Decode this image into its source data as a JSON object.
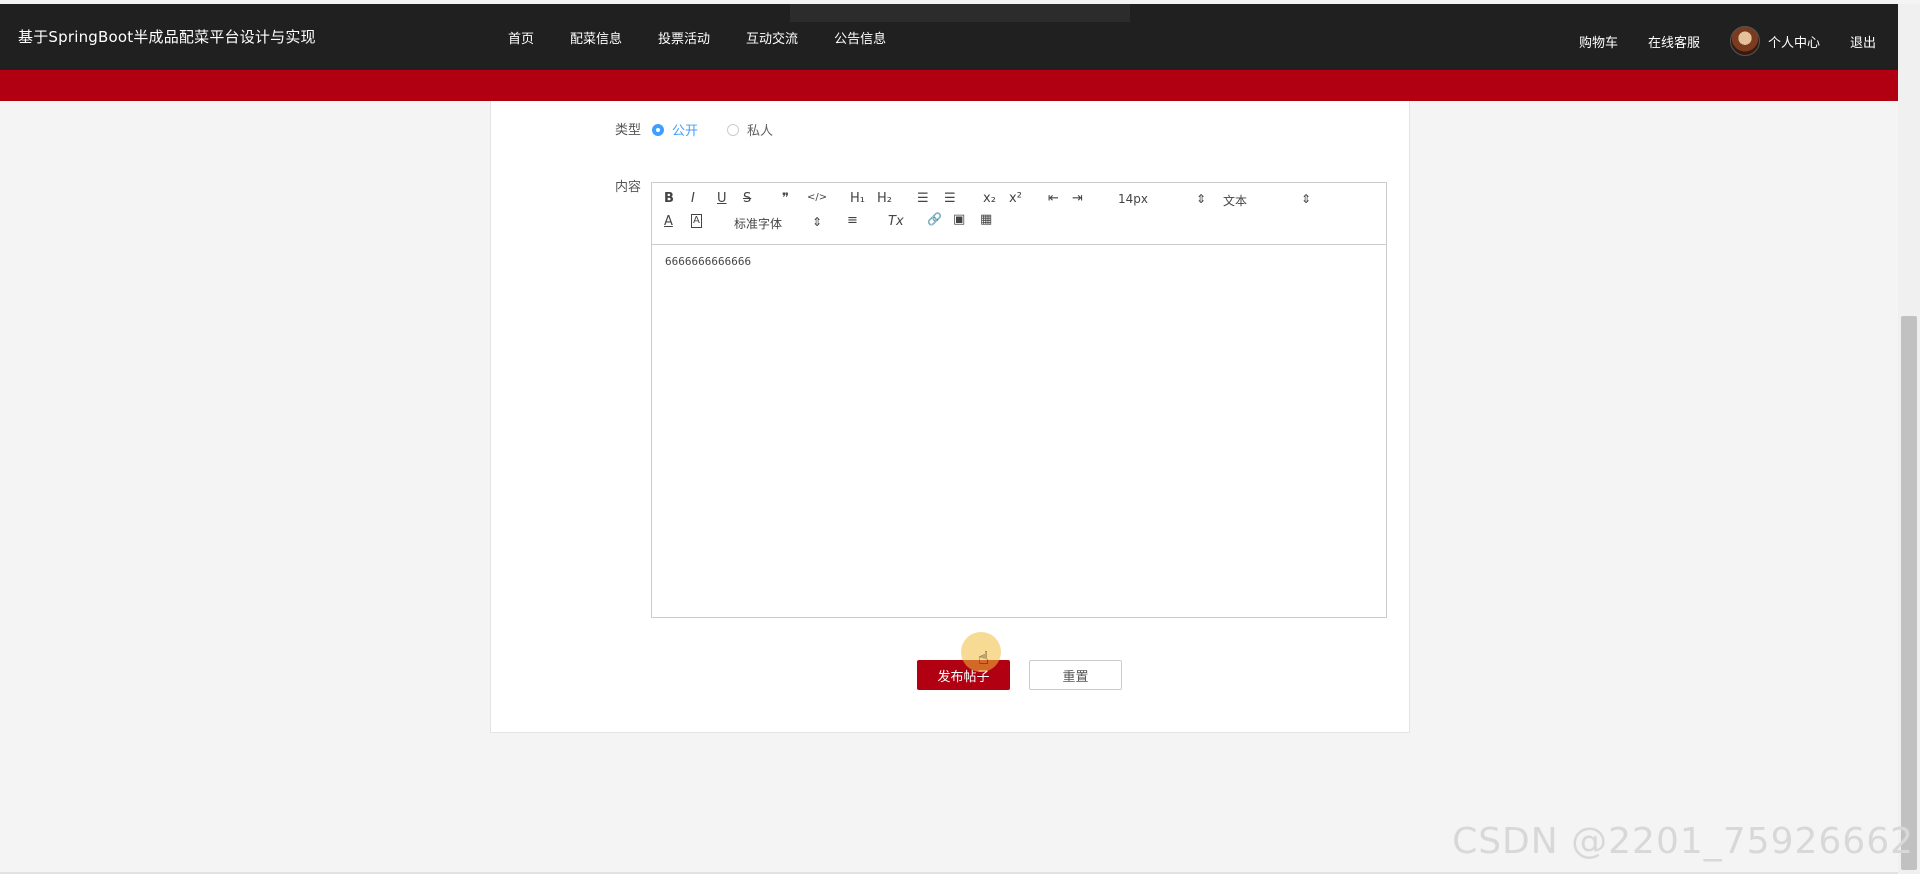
{
  "header": {
    "title": "基于SpringBoot半成品配菜平台设计与实现",
    "nav": [
      "首页",
      "配菜信息",
      "投票活动",
      "互动交流",
      "公告信息"
    ],
    "cart": "购物车",
    "service": "在线客服",
    "profile": "个人中心",
    "logout": "退出"
  },
  "form": {
    "type_label": "类型",
    "type_options": [
      {
        "label": "公开",
        "selected": true
      },
      {
        "label": "私人",
        "selected": false
      }
    ],
    "content_label": "内容",
    "editor": {
      "toolbar": {
        "bold": "B",
        "italic": "I",
        "underline": "U",
        "strike": "S",
        "quote": "❞",
        "code": "</>",
        "h1": "H₁",
        "h2": "H₂",
        "ordered_list": "☰",
        "bullet_list": "☰",
        "subscript": "x₂",
        "superscript": "x²",
        "outdent": "⇤",
        "indent": "⇥",
        "font_size": "14px",
        "header_select": "文本",
        "font_color": "A",
        "background": "A",
        "font_family": "标准字体",
        "align": "≡",
        "clean": "Tx",
        "link": "🔗",
        "image": "▣",
        "video": "▦"
      },
      "content": "6666666666666"
    },
    "submit": "发布帖子",
    "reset": "重置"
  },
  "watermark": "CSDN @2201_75926662"
}
